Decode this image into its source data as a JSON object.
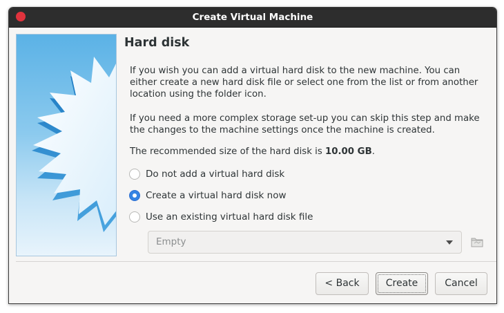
{
  "window": {
    "title": "Create Virtual Machine"
  },
  "page": {
    "heading": "Hard disk",
    "para1": "If you wish you can add a virtual hard disk to the new machine. You can either create a new hard disk file or select one from the list or from another location using the folder icon.",
    "para2": "If you need a more complex storage set-up you can skip this step and make the changes to the machine settings once the machine is created.",
    "recommended_prefix": "The recommended size of the hard disk is ",
    "recommended_size": "10.00 GB",
    "recommended_suffix": "."
  },
  "options": [
    {
      "label": "Do not add a virtual hard disk",
      "checked": false
    },
    {
      "label": "Create a virtual hard disk now",
      "checked": true
    },
    {
      "label": "Use an existing virtual hard disk file",
      "checked": false
    }
  ],
  "disk_select": {
    "value": "Empty",
    "icon": "folder-icon"
  },
  "buttons": {
    "back": "< Back",
    "create": "Create",
    "cancel": "Cancel"
  },
  "colors": {
    "accent": "#3584e4",
    "titlebar": "#2d2d2d",
    "close": "#e0333d"
  }
}
